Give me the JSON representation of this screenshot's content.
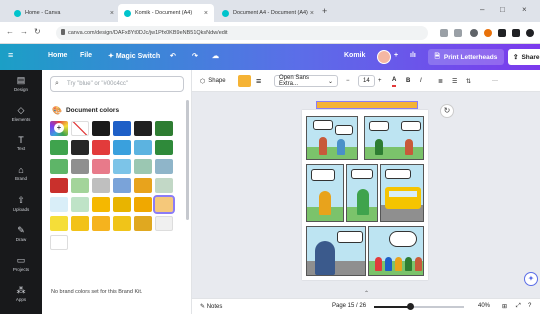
{
  "browser": {
    "tabs": [
      {
        "label": "Home - Canva",
        "active": false
      },
      {
        "label": "Komik - Document (A4)",
        "active": true
      },
      {
        "label": "Document A4 - Document (A4)",
        "active": false
      }
    ],
    "url": "canva.com/design/DAFx8Yt0DJc/jw1Pfx0KB9eNB51QksNdw/edit"
  },
  "topbar": {
    "home": "Home",
    "file": "File",
    "magic_switch": "Magic Switch",
    "doc_name": "Komik",
    "print_label": "Print Letterheads",
    "share_label": "Share"
  },
  "rail": {
    "items": [
      {
        "label": "Design",
        "icon": "layout-icon"
      },
      {
        "label": "Elements",
        "icon": "shapes-icon"
      },
      {
        "label": "Text",
        "icon": "text-icon"
      },
      {
        "label": "Brand",
        "icon": "brand-icon"
      },
      {
        "label": "Uploads",
        "icon": "upload-icon"
      },
      {
        "label": "Draw",
        "icon": "draw-icon"
      },
      {
        "label": "Projects",
        "icon": "folder-icon"
      },
      {
        "label": "Apps",
        "icon": "apps-icon"
      }
    ]
  },
  "colors_panel": {
    "search_placeholder": "Try \"blue\" or \"#00c4cc\"",
    "section_title": "Document colors",
    "swatches": [
      "#ffffff",
      "none",
      "#1a1a1a",
      "#1e5fc7",
      "#202020",
      "#2e7d32",
      "#3fa34d",
      "#262626",
      "#e23b3b",
      "#3aa0dd",
      "#5cb3e0",
      "#2f8a3a",
      "#5eb568",
      "#8f8f8f",
      "#e87a8a",
      "#7cc4e8",
      "#9bc7b2",
      "#8fb5c9",
      "#c9302c",
      "#a3d49a",
      "#bfbfbf",
      "#7aa3d9",
      "#e8a31c",
      "#c2d8c6",
      "#d9eef8",
      "#bfe3c7",
      "#f5b800",
      "#e8b400",
      "#f0a800",
      "#f5c87a",
      "#f5de38",
      "#f2c218",
      "#f5b31e",
      "#f0c419",
      "#e0a820",
      "#f0f0f0",
      "#ffffff"
    ],
    "brand_note": "No brand colors set for this Brand Kit."
  },
  "toolbar": {
    "shape": "Shape",
    "font": "Open Sans Extra...",
    "font_size": "14",
    "fill_color": "#f5b335"
  },
  "bottombar": {
    "notes": "Notes",
    "page": "Page 15 / 26",
    "zoom": "40%",
    "zoom_fraction": 0.4
  }
}
